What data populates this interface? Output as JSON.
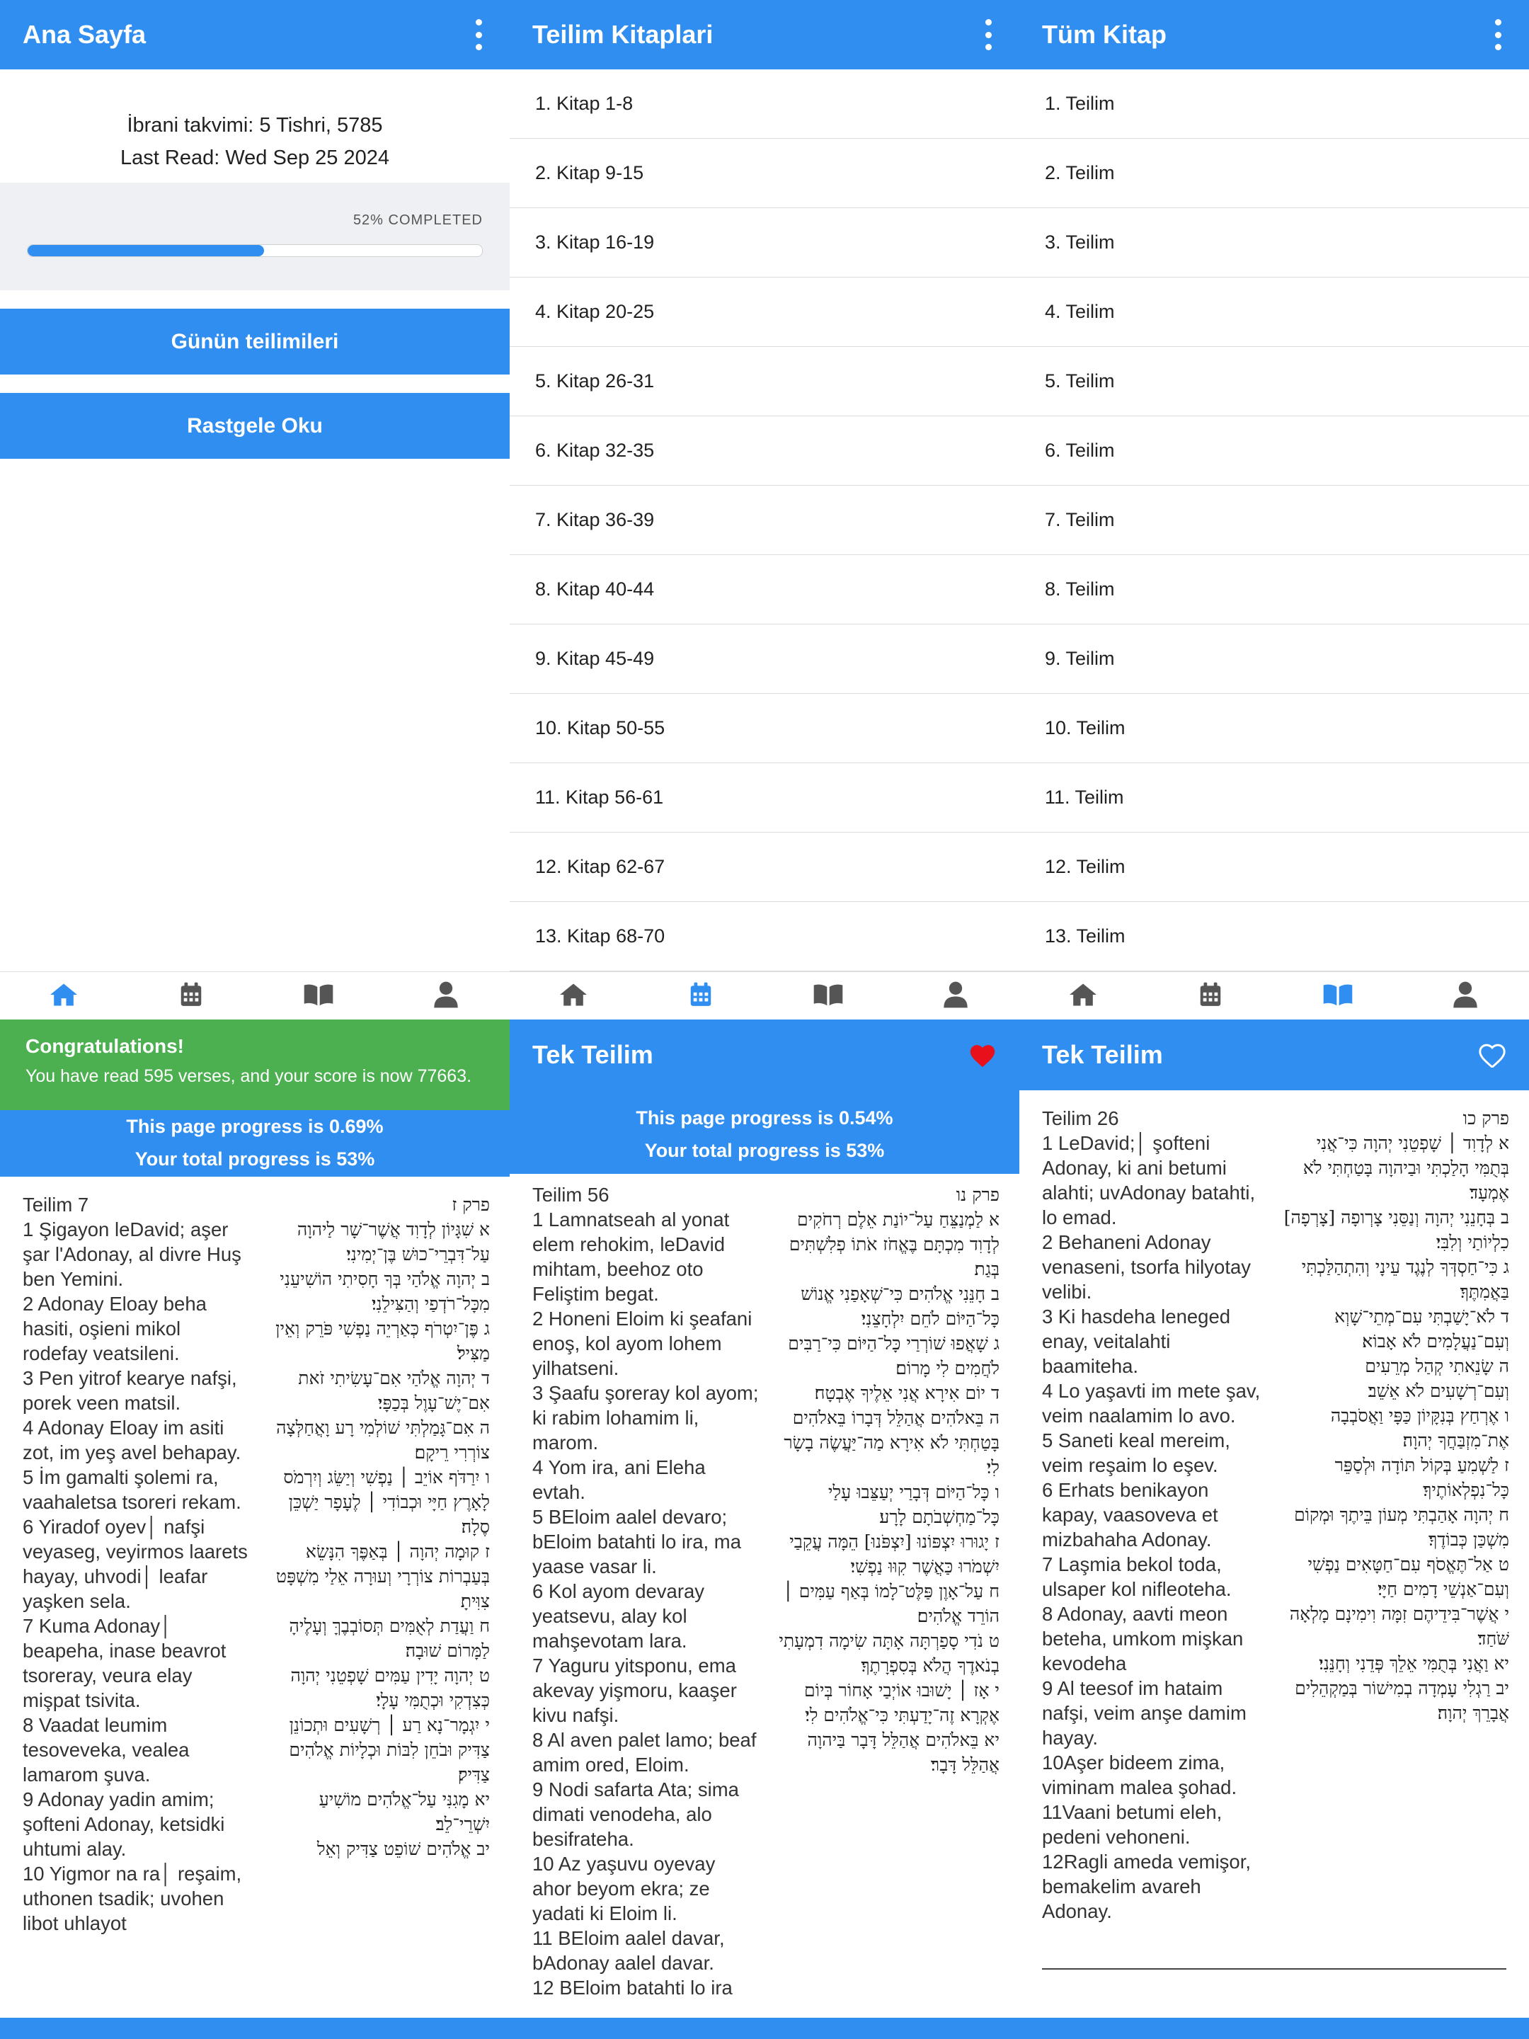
{
  "home": {
    "title": "Ana Sayfa",
    "hebrew_date": "İbrani takvimi: 5 Tishri, 5785",
    "last_read": "Last Read: Wed Sep 25 2024",
    "completed_label": "52% COMPLETED",
    "progress_fraction": 0.52,
    "btn_daily": "Günün teilimileri",
    "btn_random": "Rastgele Oku"
  },
  "books": {
    "title": "Teilim Kitaplari",
    "items": [
      "1. Kitap 1-8",
      "2. Kitap 9-15",
      "3. Kitap 16-19",
      "4. Kitap 20-25",
      "5. Kitap 26-31",
      "6. Kitap 32-35",
      "7. Kitap 36-39",
      "8. Kitap 40-44",
      "9. Kitap 45-49",
      "10. Kitap 50-55",
      "11. Kitap 56-61",
      "12. Kitap 62-67",
      "13. Kitap 68-70"
    ]
  },
  "all": {
    "title": "Tüm Kitap",
    "items": [
      "1. Teilim",
      "2. Teilim",
      "3. Teilim",
      "4. Teilim",
      "5. Teilim",
      "6. Teilim",
      "7. Teilim",
      "8. Teilim",
      "9. Teilim",
      "10. Teilim",
      "11. Teilim",
      "12. Teilim",
      "13. Teilim"
    ]
  },
  "nav": {
    "icons": [
      "home-icon",
      "calendar-icon",
      "book-icon",
      "person-icon"
    ],
    "active_color": "#2f8ef0",
    "inactive_color": "#555555"
  },
  "reader1": {
    "congrats_title": "Congratulations!",
    "congrats_msg": "You have read 595 verses, and your score is now 77663.",
    "page_progress": "This page progress is 0.69%",
    "total_progress": "Your total progress is 53%",
    "latin": [
      "Teilim 7",
      "1 Şigayon leDavid; aşer şar l'Adonay, al divre Huş ben Yemini.",
      "2 Adonay Eloay beha hasiti, oşieni mikol rodefay veatsileni.",
      "3 Pen yitrof kearye nafşi, porek veen matsil.",
      "4 Adonay Eloay im asiti zot, im yeş avel behapay.",
      "5 İm gamalti şolemi ra, vaahaletsa tsoreri rekam.",
      "6 Yiradof oyev│ nafşi veyaseg, veyirmos laarets hayay, uhvodi│ leafar yaşken sela.",
      "7 Kuma Adonay│ beapeha, inase beavrot tsoreray, veura elay mişpat tsivita.",
      "8 Vaadat leumim tesoveveka, vealea lamarom şuva.",
      "9 Adonay yadin amim; şofteni Adonay, ketsidki uhtumi alay.",
      "10 Yigmor na ra│ reşaim, uthonen tsadik; uvohen libot uhlayot"
    ],
    "hebrew": [
      "פרק ז",
      "א שִׁגָּיוֹן לְדָוִד אֲשֶׁר־שָׁר לַיהוָה עַל־דִּבְרֵי־כוּשׁ בֶּן־יְמִינִי׃",
      "ב יְהוָה אֱלֹהַי בְּךָ חָסִיתִי הוֹשִׁיעֵנִי מִכָּל־רֹדְפַי וְהַצִּילֵנִי׃",
      "ג פֶּן־יִטְרֹף כְּאַרְיֵה נַפְשִׁי פֹּרֵק וְאֵין מַצִּיל׃",
      "ד יְהוָה אֱלֹהַי אִם־עָשִׂיתִי זֹאת אִם־יֶשׁ־עָוֶל בְּכַפָּי׃",
      "ה אִם־גָּמַלְתִּי שׁוֹלְמִי רָע וָאֲחַלְּצָה צוֹרְרִי רֵיקָם׃",
      "ו יִרַדֹּף אוֹיֵב │ נַפְשִׁי וְיַשֵּׂג וְיִרְמֹס לָאָרֶץ חַיָּי וּכְבוֹדִי │ לֶעָפָר יַשְׁכֵּן סֶלָה׃",
      "ז קוּמָה יְהוָה │ בְּאַפֶּךָ הִנָּשֵׂא בְּעַבְרוֹת צוֹרְרָי וְעוּרָה אֵלַי מִשְׁפָּט צִוִּיתָ׃",
      "ח וַעֲדַת לְאֻמִּים תְּסוֹבְבֶךָּ וְעָלֶיהָ לַמָּרוֹם שׁוּבָה׃",
      "ט יְהוָה יָדִין עַמִּים שָׁפְטֵנִי יְהוָה כְּצִדְקִי וּכְתֻמִּי עָלָי׃",
      "י יִגְמָר־נָא רַע │ רְשָׁעִים וּתְכוֹנֵן צַדִּיק וּבֹחֵן לִבּוֹת וּכְלָיוֹת אֱלֹהִים צַדִּיק׃",
      "יא מָגִנִּי עַל־אֱלֹהִים מוֹשִׁיעַ יִשְׁרֵי־לֵב׃",
      "יב אֱלֹהִים שׁוֹפֵט צַדִּיק וְאֵל"
    ]
  },
  "reader2": {
    "title": "Tek Teilim",
    "page_progress": "This page progress is 0.54%",
    "total_progress": "Your total progress is 53%",
    "heart_color": "#e8111b",
    "latin": [
      "Teilim 56",
      "1 Lamnatseah al yonat elem rehokim, leDavid mihtam, beehoz oto Feliştim begat.",
      "2 Honeni Eloim ki şeafani enoş, kol ayom lohem yilhatseni.",
      "3 Şaafu şoreray kol ayom; ki rabim lohamim li, marom.",
      "4 Yom ira, ani Eleha evtah.",
      "5 BEloim aalel devaro; bEloim batahti lo ira, ma yaase vasar li.",
      "6 Kol ayom devaray yeatsevu, alay kol mahşevotam lara.",
      "7 Yaguru yitsponu, ema akevay yişmoru, kaaşer kivu nafşi.",
      "8 Al aven palet lamo; beaf amim ored, Eloim.",
      "9 Nodi safarta Ata; sima dimati venodeha, alo besifrateha.",
      "10 Az yaşuvu oyevay ahor beyom ekra; ze yadati ki Eloim li.",
      "11 BEloim aalel davar, bAdonay aalel davar.",
      "12 BEloim batahti lo ira"
    ],
    "hebrew": [
      "פרק נו",
      "א לַמְנַצֵּחַ עַל־יוֹנַת אֵלֶם רְחֹקִים לְדָוִד מִכְתָּם בֶּאֱחֹז אֹתוֹ פְלִשְׁתִּים בְּגַת׃",
      "ב חָנֵּנִי אֱלֹהִים כִּי־שְׁאָפַנִי אֱנוֹשׁ כָּל־הַיּוֹם לֹחֵם יִלְחָצֵנִי׃",
      "ג שָׁאֲפוּ שׁוֹרְרַי כָּל־הַיּוֹם כִּי־רַבִּים לֹחֲמִים לִי מָרוֹם׃",
      "ד יוֹם אִירָא אֲנִי אֵלֶיךָ אֶבְטָח׃",
      "ה בֵּאלֹהִים אֲהַלֵּל דְּבָרוֹ בֵּאלֹהִים בָּטַחְתִּי לֹא אִירָא מַה־יַּעֲשֶׂה בָשָׂר לִי׃",
      "ו כָּל־הַיּוֹם דְּבָרַי יְעַצֵּבוּ עָלַי כָּל־מַחְשְׁבֹתָם לָרָע׃",
      "ז יָגוּרוּ יִצְפּוֹנוּ [יִצְפֹּנוּ] הֵמָּה עֲקֵבַי יִשְׁמֹרוּ כַּאֲשֶׁר קִוּוּ נַפְשִׁי׃",
      "ח עַל־אָוֶן פַּלֶּט־לָמוֹ בְּאַף עַמִּים │ הוֹרֵד אֱלֹהִים׃",
      "ט נֹדִי סָפַרְתָּה אָתָּה שִׂימָה דִמְעָתִי בְנֹאדֶךָ הֲלֹא בְּסִפְרָתֶךָ׃",
      "י אָז │ יָשׁוּבוּ אוֹיְבַי אָחוֹר בְּיוֹם אֶקְרָא זֶה־יָדַעְתִּי כִּי־אֱלֹהִים לִי׃",
      "יא בֵּאלֹהִים אֲהַלֵּל דָּבָר בַּיהוָה אֲהַלֵּל דָּבָר׃"
    ]
  },
  "reader3": {
    "title": "Tek Teilim",
    "latin": [
      "Teilim 26",
      "1 LeDavid;│ şofteni Adonay, ki ani betumi alahti; uvAdonay batahti, lo emad.",
      "2 Behaneni Adonay venaseni, tsorfa hilyotay velibi.",
      "3 Ki hasdeha leneged enay, veitalahti baamiteha.",
      "4 Lo yaşavti im mete şav, veim naalamim lo avo.",
      "5 Saneti keal mereim, veim reşaim lo eşev.",
      "6 Erhats benikayon kapay, vaasoveva et mizbahaha Adonay.",
      "7 Laşmia bekol toda, ulsaper kol nifleoteha.",
      "8 Adonay, aavti meon beteha, umkom mişkan kevodeha",
      "9 Al teesof im hataim nafşi, veim anşe damim hayay.",
      "10Aşer bideem zima, viminam malea şohad.",
      "11Vaani betumi eleh, pedeni vehoneni.",
      "12Ragli ameda vemişor, bemakelim avareh Adonay."
    ],
    "hebrew": [
      "פרק כו",
      "א לְדָוִד │ שָׁפְטֵנִי יְהוָה כִּי־אֲנִי בְּתֻמִּי הָלַכְתִּי וּבַיהוָה בָּטַחְתִּי לֹא אֶמְעָד׃",
      "ב בְּחָנֵנִי יְהוָה וְנַסֵּנִי צָרְופָה [צָרְפָה] כִלְיוֹתַי וְלִבִּי׃",
      "ג כִּי־חַסְדְּךָ לְנֶגֶד עֵינָי וְהִתְהַלַּכְתִּי בַּאֲמִתֶּךָ׃",
      "ד לֹא־יָשַׁבְתִּי עִם־מְתֵי־שָׁוְא וְעִם־נַעֲלָמִים לֹא אָבוֹא׃",
      "ה שָׂנֵאתִי קְהַל מְרֵעִים וְעִם־רְשָׁעִים לֹא אֵשֵׁב׃",
      "ו אֶרְחַץ בְּנִקָּיוֹן כַּפָּי וַאֲסֹבְבָה אֶת־מִזְבַּחֲךָ יְהוָה׃",
      "ז לַשְׁמִעַ בְּקוֹל תּוֹדָה וּלְסַפֵּר כָּל־נִפְלְאוֹתֶיךָ׃",
      "ח יְהוָה אָהַבְתִּי מְעוֹן בֵּיתֶךָ וּמְקוֹם מִשְׁכַּן כְּבוֹדֶךָ׃",
      "ט אַל־תֶּאֱסֹף עִם־חַטָּאִים נַפְשִׁי וְעִם־אַנְשֵׁי דָמִים חַיָּי׃",
      "י אֲשֶׁר־בִּידֵיהֶם זִמָּה וִימִינָם מָלְאָה שֹּׁחַד׃",
      "יא וַאֲנִי בְּתֻמִּי אֵלֵךְ פְּדֵנִי וְחָנֵּנִי׃",
      "יב רַגְלִי עָמְדָה בְמִישׁוֹר בְּמַקְהֵלִים אֲבָרֵךְ יְהוָה׃"
    ]
  }
}
